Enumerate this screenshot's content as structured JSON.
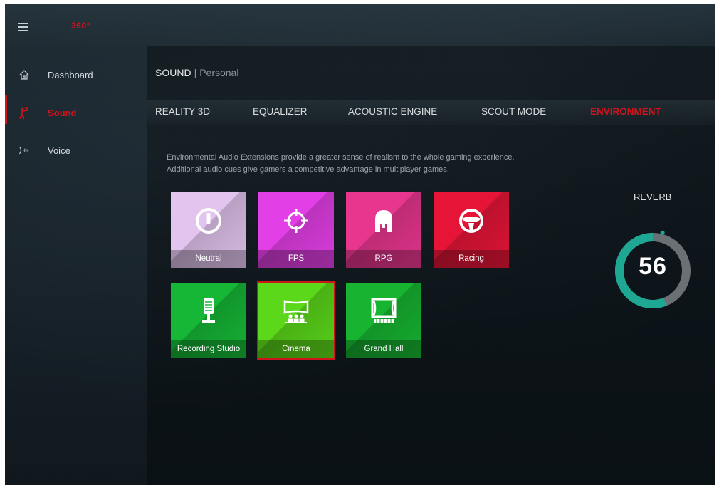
{
  "app": {
    "brand": "360°"
  },
  "sidebar": {
    "items": [
      {
        "label": "Dashboard",
        "icon": "home-icon"
      },
      {
        "label": "Sound",
        "icon": "sound-icon",
        "active": true
      },
      {
        "label": "Voice",
        "icon": "voice-icon"
      }
    ]
  },
  "header": {
    "section": "SOUND",
    "separator": "|",
    "profile": "Personal"
  },
  "tabs": [
    {
      "label": "REALITY 3D"
    },
    {
      "label": "EQUALIZER"
    },
    {
      "label": "ACOUSTIC ENGINE"
    },
    {
      "label": "SCOUT MODE"
    },
    {
      "label": "ENVIRONMENT",
      "active": true
    }
  ],
  "description": {
    "line1": "Environmental Audio Extensions provide a greater sense of realism to the whole gaming experience.",
    "line2": "Additional audio cues give gamers a competitive advantage in multiplayer games."
  },
  "environments": [
    {
      "label": "Neutral",
      "icon": "power-icon",
      "color": "#e2c4ee"
    },
    {
      "label": "FPS",
      "icon": "crosshair-icon",
      "color": "#e33fe6"
    },
    {
      "label": "RPG",
      "icon": "helmet-icon",
      "color": "#e8368f"
    },
    {
      "label": "Racing",
      "icon": "steering-wheel-icon",
      "color": "#e61538"
    },
    {
      "label": "Recording Studio",
      "icon": "microphone-icon",
      "color": "#16b736"
    },
    {
      "label": "Cinema",
      "icon": "cinema-icon",
      "color": "#5bd81a",
      "selected": true
    },
    {
      "label": "Grand Hall",
      "icon": "stage-icon",
      "color": "#17b431"
    }
  ],
  "reverb": {
    "label": "REVERB",
    "value": "56",
    "level_percent": 56,
    "colors": {
      "fill": "#1ea894",
      "track": "#6b7075"
    }
  },
  "colors": {
    "accent": "#d0141b"
  }
}
